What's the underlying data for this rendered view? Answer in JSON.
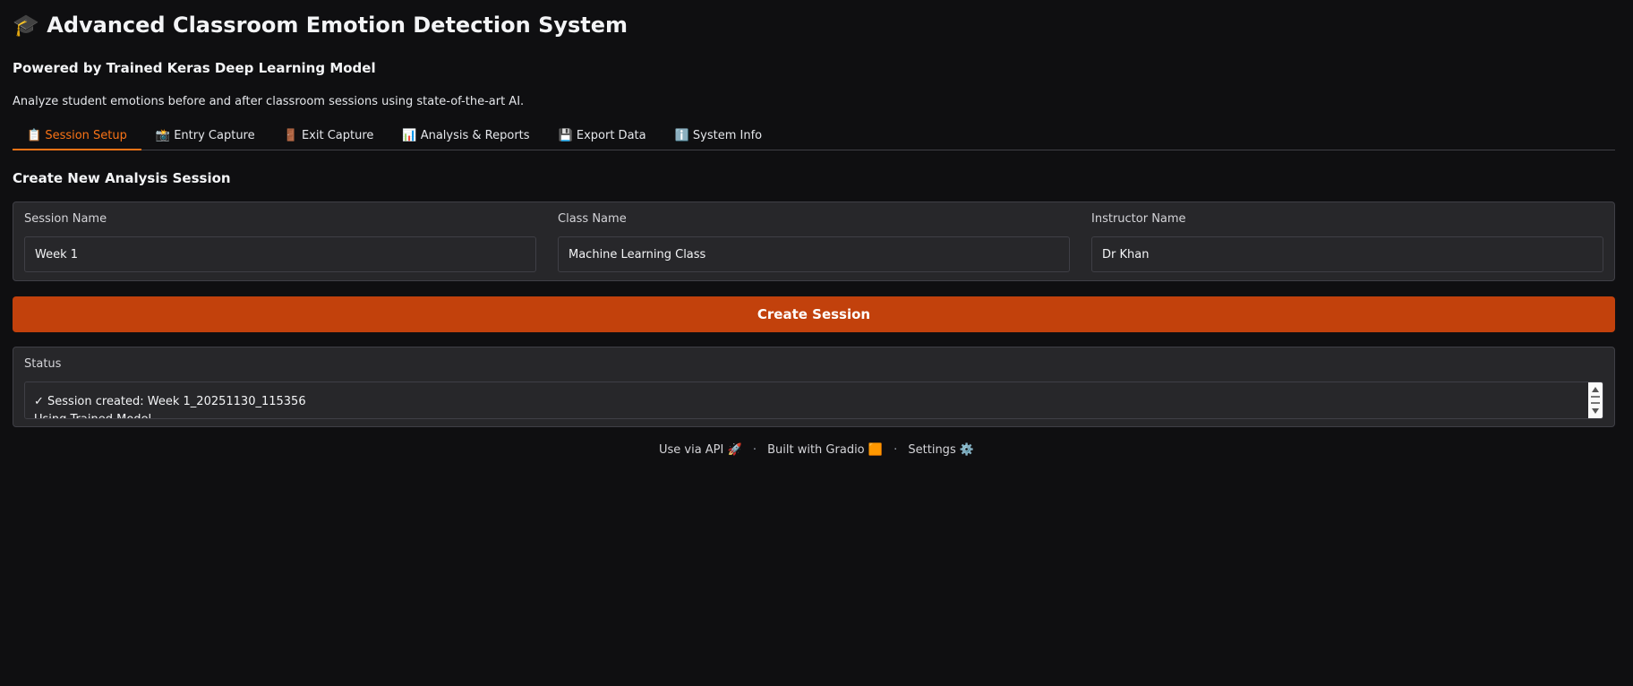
{
  "header": {
    "title": "🎓 Advanced Classroom Emotion Detection System",
    "subtitle": "Powered by Trained Keras Deep Learning Model",
    "description": "Analyze student emotions before and after classroom sessions using state-of-the-art AI."
  },
  "tabs": [
    {
      "label": "📋 Session Setup",
      "active": true
    },
    {
      "label": "📸 Entry Capture",
      "active": false
    },
    {
      "label": "🚪 Exit Capture",
      "active": false
    },
    {
      "label": "📊 Analysis & Reports",
      "active": false
    },
    {
      "label": "💾 Export Data",
      "active": false
    },
    {
      "label": "ℹ️ System Info",
      "active": false
    }
  ],
  "section": {
    "title": "Create New Analysis Session"
  },
  "fields": {
    "session_name": {
      "label": "Session Name",
      "value": "Week 1"
    },
    "class_name": {
      "label": "Class Name",
      "value": "Machine Learning Class"
    },
    "instructor_name": {
      "label": "Instructor Name",
      "value": "Dr Khan"
    }
  },
  "create_button": {
    "label": "Create Session"
  },
  "status": {
    "label": "Status",
    "line1": "✓ Session created: Week 1_20251130_115356",
    "line2": "Using Trained Model"
  },
  "footer": {
    "api": "Use via API 🚀",
    "gradio": "Built with Gradio 🟧",
    "settings": "Settings ⚙️",
    "separator": "·"
  },
  "colors": {
    "accent": "#f97316",
    "button": "#c2410c",
    "background": "#0f0f11",
    "panel": "#27272a"
  }
}
